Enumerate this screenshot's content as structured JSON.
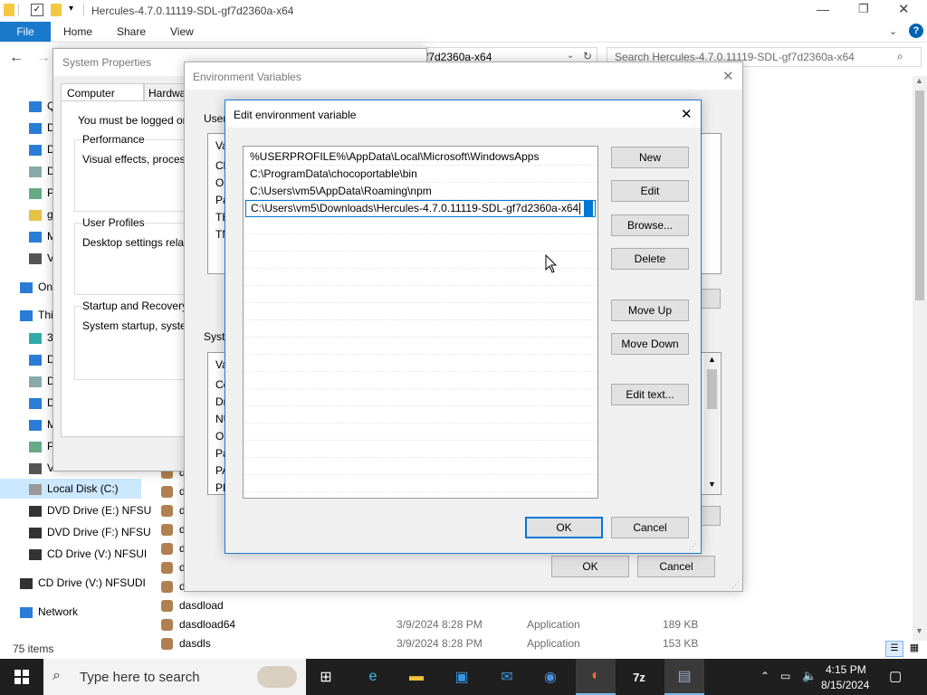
{
  "explorer": {
    "title": "Hercules-4.7.0.11119-SDL-gf7d2360a-x64",
    "ribbon": {
      "file": "File",
      "home": "Home",
      "share": "Share",
      "view": "View"
    },
    "address_tail": "f7d2360a-x64",
    "search_placeholder": "Search Hercules-4.7.0.11119-SDL-gf7d2360a-x64",
    "nav": [
      {
        "label": "Qu",
        "icon": "star-icon"
      },
      {
        "label": "D",
        "icon": "desktop-icon"
      },
      {
        "label": "D",
        "icon": "download-icon"
      },
      {
        "label": "D",
        "icon": "document-icon"
      },
      {
        "label": "P",
        "icon": "picture-icon"
      },
      {
        "label": "g",
        "icon": "folder-icon"
      },
      {
        "label": "M",
        "icon": "music-icon"
      },
      {
        "label": "V",
        "icon": "video-icon"
      },
      {
        "label": "On",
        "icon": "cloud-icon"
      },
      {
        "label": "Thi",
        "icon": "pc-icon"
      },
      {
        "label": "3",
        "icon": "cube-icon"
      },
      {
        "label": "D",
        "icon": "desktop-icon"
      },
      {
        "label": "D",
        "icon": "document-icon"
      },
      {
        "label": "D",
        "icon": "download-icon"
      },
      {
        "label": "M",
        "icon": "music-icon"
      },
      {
        "label": "P",
        "icon": "picture-icon"
      },
      {
        "label": "V",
        "icon": "video-icon"
      },
      {
        "label": "Local Disk (C:)",
        "icon": "disk-icon"
      },
      {
        "label": "DVD Drive (E:) NFSU",
        "icon": "dvd-icon"
      },
      {
        "label": "DVD Drive (F:) NFSU",
        "icon": "dvd-icon"
      },
      {
        "label": "CD Drive (V:) NFSUI",
        "icon": "cd-icon"
      },
      {
        "label": "CD Drive (V:) NFSUDI",
        "icon": "cd-icon"
      },
      {
        "label": "Network",
        "icon": "network-icon"
      }
    ],
    "files": [
      {
        "name": "d"
      },
      {
        "name": "d"
      },
      {
        "name": "d"
      },
      {
        "name": "d"
      },
      {
        "name": "d"
      },
      {
        "name": "d"
      },
      {
        "name": "d"
      },
      {
        "name": "dasdload"
      },
      {
        "name": "dasdload64",
        "date": "3/9/2024 8:28 PM",
        "type": "Application",
        "size": "189 KB"
      },
      {
        "name": "dasdls",
        "date": "3/9/2024 8:28 PM",
        "type": "Application",
        "size": "153 KB"
      }
    ],
    "status": "75 items"
  },
  "system_properties": {
    "title": "System Properties",
    "tabs": [
      "Computer Name",
      "Hardwar"
    ],
    "logged_on_note": "You must be logged on as",
    "performance": {
      "title": "Performance",
      "desc": "Visual effects, processor"
    },
    "user_profiles": {
      "title": "User Profiles",
      "desc": "Desktop settings related"
    },
    "startup": {
      "title": "Startup and Recovery",
      "desc": "System startup, system f"
    }
  },
  "env_vars": {
    "title": "Environment Variables",
    "user_label": "User",
    "user_col": "Va",
    "user_rows": [
      "Ch",
      "Or",
      "Pa",
      "TE",
      "TM"
    ],
    "system_label": "Syste",
    "system_col": "Va",
    "system_rows": [
      "Co",
      "Dr",
      "NU",
      "OS",
      "Pa",
      "PA",
      "PR"
    ],
    "ok": "OK",
    "cancel": "Cancel"
  },
  "edit_dialog": {
    "title": "Edit environment variable",
    "entries": [
      "%USERPROFILE%\\AppData\\Local\\Microsoft\\WindowsApps",
      "C:\\ProgramData\\chocoportable\\bin",
      "C:\\Users\\vm5\\AppData\\Roaming\\npm",
      "C:\\Users\\vm5\\Downloads\\Hercules-4.7.0.11119-SDL-gf7d2360a-x64"
    ],
    "buttons": {
      "new": "New",
      "edit": "Edit",
      "browse": "Browse...",
      "delete": "Delete",
      "move_up": "Move Up",
      "move_down": "Move Down",
      "edit_text": "Edit text...",
      "ok": "OK",
      "cancel": "Cancel"
    }
  },
  "taskbar": {
    "search_placeholder": "Type here to search",
    "time": "4:15 PM",
    "date": "8/15/2024",
    "apps": [
      "task-view-icon",
      "edge-icon",
      "explorer-icon",
      "store-icon",
      "mail-icon",
      "chrome-icon",
      "firefox-icon",
      "7zip-icon",
      "network-app-icon"
    ]
  },
  "colors": {
    "accent": "#0078d7",
    "file_tab": "#1979ca",
    "taskbar": "#1f1f1f"
  }
}
